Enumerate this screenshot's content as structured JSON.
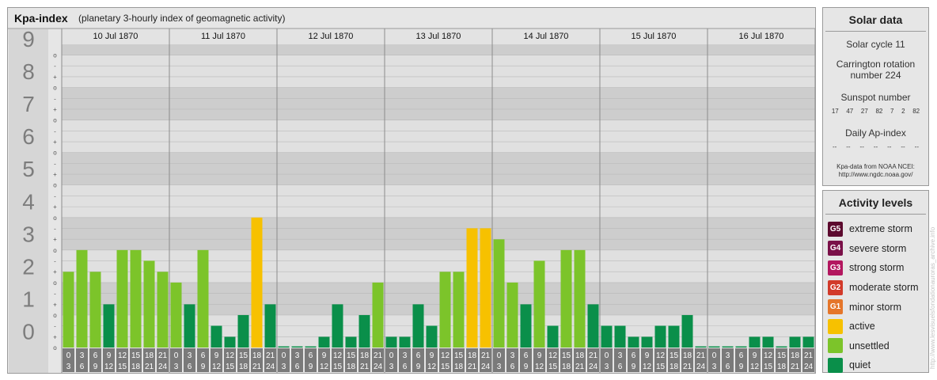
{
  "header": {
    "title": "Kpa-index",
    "subtitle": "(planetary 3-hourly index of geomagnetic activity)"
  },
  "solar": {
    "title": "Solar data",
    "cycle": "Solar cycle 11",
    "carrington_line1": "Carrington rotation",
    "carrington_line2": "number 224",
    "sunspot_title": "Sunspot number",
    "sunspot_values": [
      "17",
      "47",
      "27",
      "82",
      "7",
      "2",
      "82"
    ],
    "ap_title": "Daily Ap-index",
    "ap_values": [
      "--",
      "--",
      "--",
      "--",
      "--",
      "--",
      "--"
    ],
    "source_line1": "Kpa-data from NOAA NCEI:",
    "source_line2": "http://www.ngdc.noaa.gov/"
  },
  "levels": {
    "title": "Activity levels",
    "items": [
      {
        "badge": "G5",
        "label": "extreme storm",
        "color": "#5c0a2e"
      },
      {
        "badge": "G4",
        "label": "severe storm",
        "color": "#7a1048"
      },
      {
        "badge": "G3",
        "label": "strong storm",
        "color": "#b3175f"
      },
      {
        "badge": "G2",
        "label": "moderate storm",
        "color": "#d23a2a"
      },
      {
        "badge": "G1",
        "label": "minor storm",
        "color": "#e5762a"
      },
      {
        "badge": "",
        "label": "active",
        "color": "#f7c100"
      },
      {
        "badge": "",
        "label": "unsettled",
        "color": "#7cc42a"
      },
      {
        "badge": "",
        "label": "quiet",
        "color": "#0a8f4a"
      }
    ]
  },
  "watermark": "http://www.lesvisuelsfondationauroras_archive.info",
  "chart_data": {
    "type": "bar",
    "days": [
      "10 Jul 1870",
      "11 Jul 1870",
      "12 Jul 1870",
      "13 Jul 1870",
      "14 Jul 1870",
      "15 Jul 1870",
      "16 Jul 1870"
    ],
    "hour_labels_top": [
      "0",
      "3",
      "6",
      "9",
      "12",
      "15",
      "18",
      "21"
    ],
    "hour_labels_bottom": [
      "3",
      "6",
      "9",
      "12",
      "15",
      "18",
      "21",
      "24"
    ],
    "y_ticks": [
      "0",
      "1",
      "2",
      "3",
      "4",
      "5",
      "6",
      "7",
      "8",
      "9"
    ],
    "minor_ticks": [
      "-",
      "o",
      "+"
    ],
    "ylim": [
      0,
      9.33
    ],
    "values": [
      [
        2.33,
        3.0,
        2.33,
        1.33,
        3.0,
        3.0,
        2.67,
        2.33
      ],
      [
        2.0,
        1.33,
        3.0,
        0.67,
        0.33,
        1.0,
        4.0,
        1.33
      ],
      [
        0.0,
        0.0,
        0.0,
        0.33,
        1.33,
        0.33,
        1.0,
        2.0
      ],
      [
        0.33,
        0.33,
        1.33,
        0.67,
        2.33,
        2.33,
        3.67,
        3.67
      ],
      [
        3.33,
        2.0,
        1.33,
        2.67,
        0.67,
        3.0,
        3.0,
        1.33
      ],
      [
        0.67,
        0.67,
        0.33,
        0.33,
        0.67,
        0.67,
        1.0,
        0.0
      ],
      [
        0.0,
        0.0,
        0.0,
        0.33,
        0.33,
        0.0,
        0.33,
        0.33
      ]
    ],
    "colors": {
      "quiet": "#0a8f4a",
      "unsettled": "#7cc42a",
      "active": "#f7c100"
    }
  }
}
